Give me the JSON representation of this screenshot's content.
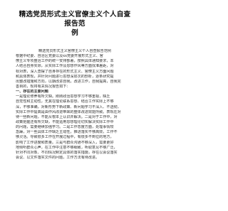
{
  "document": {
    "title_line1": "精选党员形式主义官僚主义个人自查报告范",
    "title_line2": "例",
    "subtitle": "精选党员形式主义官僚主义个人自查报告范例",
    "paragraphs": [
      "根据中纪委、自治区党委以及xx党委开展形式主义、官",
      "僚主义专项整治工作的统一安排部署，按照具体通知要求，本",
      "人结合自身实际，从实际工作及思想作风等方面找准差距，对",
      "标对表，深入查摆了自身存在的形式主义、官僚主义方面问题",
      "和具体表现，并针对问题进行思想深层次的剖析，逐条研究提",
      "出整改措施和方向，以期改进自我，改进工作，自我提高，自我完",
      "善目的，现将有关情况报告如下：",
      "一、存在的主要问题",
      "一是理论修养有所欠缺。刚刚政治思想学习不够重视，缺乏",
      "自觉性和主动性，无其在理论联系思想、结合工作实际上不够",
      "深，不够准确，对新形势下新政策、新问题学习不深入、不透彻，",
      "实际工作中提高是由作风改进带来的整体改进效能所致。表现在对",
      "待一些新问题，不能从根本上认识并解决。二是对于工作中，对",
      "政策把握还有所欠缺，不能运用思想理论切实解决实际工作中",
      "的问题，需要继续加强学习。二是工作态度方面，处理事情较",
      "急躁，对一些具体工作缺乏主动性，推进落实不够高效，工作不",
      "够灵活。导致很多工作在开展过程中，有很多不到位的地方，",
      "影响了工作进度和质量。三是与群众沟通不够深入，需要更好",
      "地倾听群众心声，在工作中注意不够细致，听取意见不够广泛，",
      "针对不同对象、不同情况制定具体的落实措施，存在以会议落实",
      "会议、以文件落实文件的问题，工作方法有待改进。"
    ]
  }
}
